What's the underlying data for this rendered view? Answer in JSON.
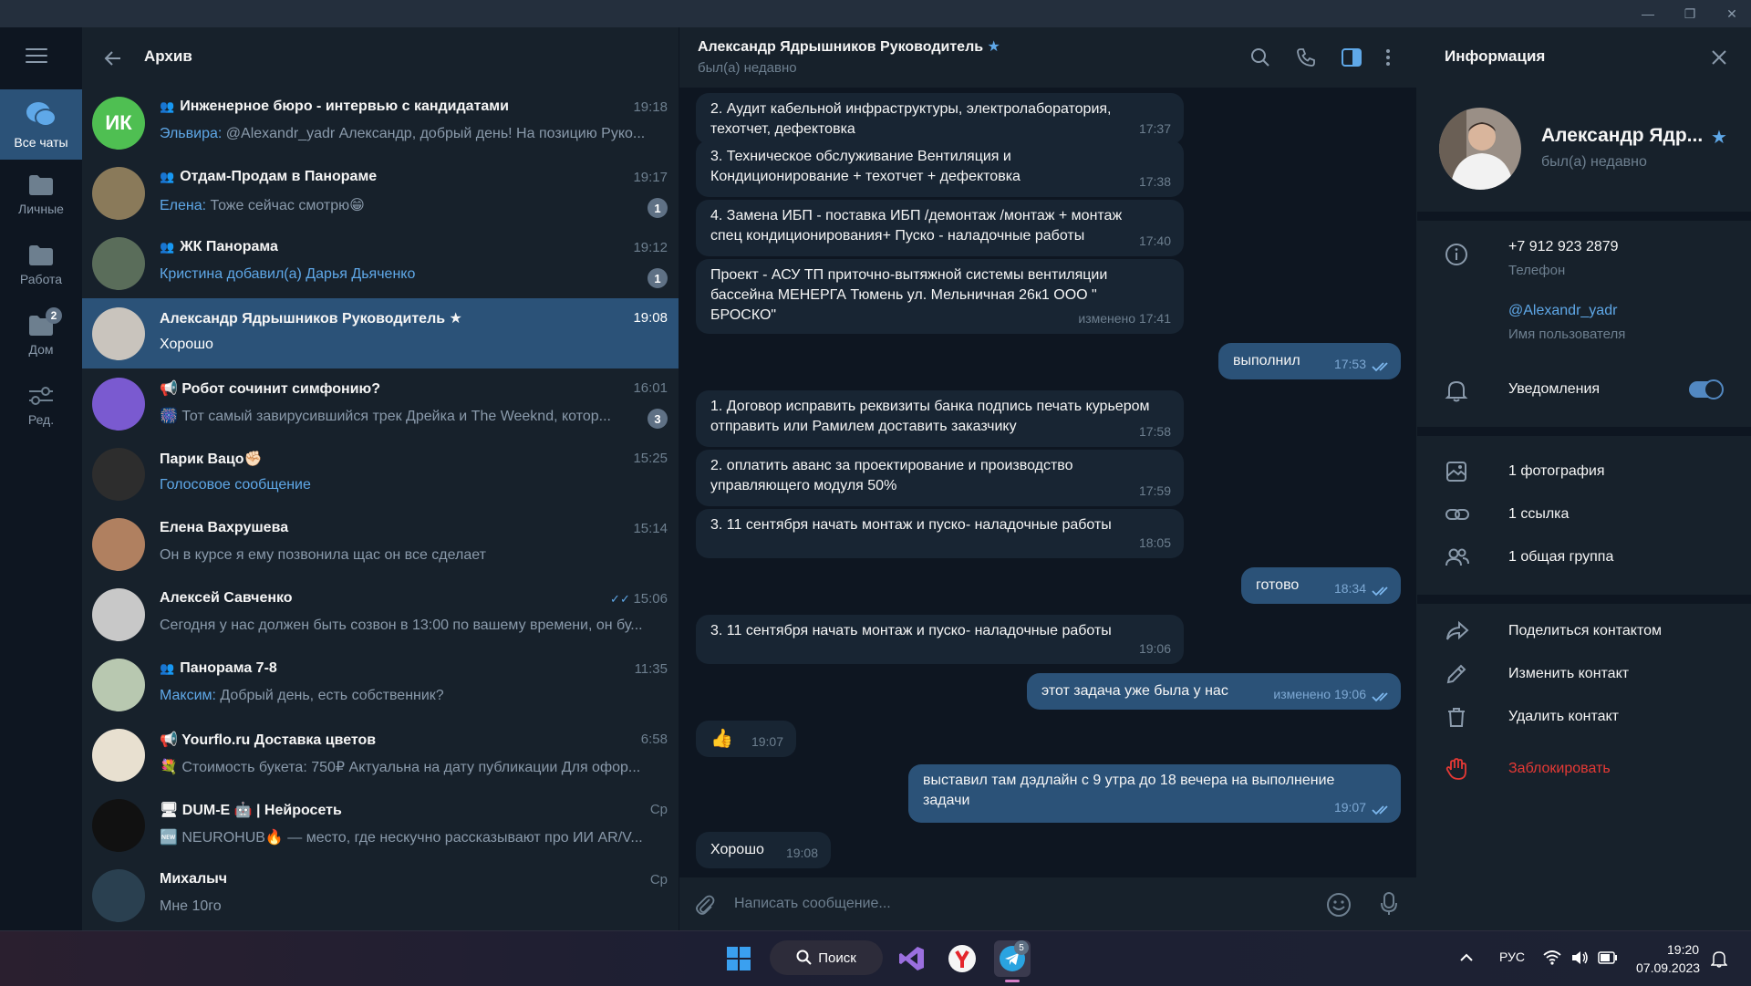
{
  "window": {
    "minimize": "—",
    "restore": "❐",
    "close": "✕"
  },
  "folders": [
    {
      "label": "Все чаты",
      "icon": "chats-icon",
      "active": true
    },
    {
      "label": "Личные",
      "icon": "folder-icon"
    },
    {
      "label": "Работа",
      "icon": "folder-icon"
    },
    {
      "label": "Дом",
      "icon": "folder-icon",
      "badge": "2"
    },
    {
      "label": "Ред.",
      "icon": "edit-folders-icon"
    }
  ],
  "list": {
    "title": "Архив",
    "chats": [
      {
        "name": "Инженерное бюро - интервью с кандидатами",
        "group": true,
        "time": "19:18",
        "sender": "Эльвира:",
        "preview": " @Alexandr_yadr  Александр, добрый день! На позицию Руко...",
        "avatar_text": "ИК",
        "avatar_color": "#4fbf52"
      },
      {
        "name": "Отдам-Продам в Панораме",
        "group": true,
        "time": "19:17",
        "sender": "Елена:",
        "preview": " Тоже сейчас смотрю😁",
        "badge": "1",
        "avatar_color": "#8a7a5a"
      },
      {
        "name": "ЖК Панорама",
        "group": true,
        "time": "19:12",
        "sender": "",
        "preview_blue": "Кристина добавил(а) Дарья Дьяченко",
        "badge": "1",
        "avatar_color": "#5a6d5a"
      },
      {
        "name": "Александр Ядрышников Руководитель ★",
        "time": "19:08",
        "preview": "Хорошо",
        "selected": true,
        "avatar_color": "#c9c4bd"
      },
      {
        "name": "📢 Робот сочинит симфонию?",
        "time": "16:01",
        "preview": "🎆 Тот самый завирусившийся трек Дрейка и The Weeknd, котор...",
        "badge": "3",
        "avatar_color": "#7a5ad0"
      },
      {
        "name": "Парик Вацо✊🏻",
        "time": "15:25",
        "preview_blue": "Голосовое сообщение",
        "avatar_color": "#2d2d2d"
      },
      {
        "name": "Елена Вахрушева",
        "time": "15:14",
        "preview": "Он в курсе я ему позвонила щас он все сделает",
        "avatar_color": "#b08060"
      },
      {
        "name": "Алексей Савченко",
        "time": "15:06",
        "read": true,
        "preview": "Сегодня у нас должен быть созвон в 13:00 по вашему времени, он бу...",
        "avatar_color": "#c8c8c8"
      },
      {
        "name": "Панорама 7-8",
        "group": true,
        "time": "11:35",
        "sender": "Максим:",
        "preview": " Добрый день, есть собственник?",
        "avatar_color": "#b8c8b0"
      },
      {
        "name": "📢 Yourflo.ru Доставка цветов",
        "time": "6:58",
        "preview": "💐 Стоимость букета: 750₽ Актуальна на дату публикации  Для офор...",
        "avatar_color": "#e8e0d0"
      },
      {
        "name": "🖥 DUM-E 🤖 | Нейросеть",
        "time": "Ср",
        "preview": "🆕 NEUROHUB🔥 — место, где нескучно рассказывают про ИИ AR/V...",
        "avatar_color": "#111111"
      },
      {
        "name": "Михалыч",
        "time": "Ср",
        "preview": "Мне 10го",
        "avatar_color": "#2a4050"
      }
    ]
  },
  "chat": {
    "title": "Александр Ядрышников Руководитель",
    "status": "был(а) недавно",
    "messages": [
      {
        "dir": "in",
        "text": "2. Аудит кабельной инфраструктуры, электролаборатория, техотчет, дефектовка",
        "time": "17:37"
      },
      {
        "dir": "in",
        "text": "3. Техническое обслуживание Вентиляция и Кондиционирование + техотчет + дефектовка",
        "time": "17:38"
      },
      {
        "dir": "in",
        "text": "4. Замена ИБП - поставка ИБП /демонтаж /монтаж + монтаж спец кондиционирования+ Пуско - наладочные работы",
        "time": "17:40"
      },
      {
        "dir": "in",
        "text": "Проект - АСУ ТП приточно-вытяжной системы вентиляции бассейна МЕНЕРГА Тюмень ул. Мельничная 26к1 ООО \" БРОСКО\"",
        "time": "изменено 17:41"
      },
      {
        "dir": "out",
        "text": "выполнил",
        "time": "17:53"
      },
      {
        "dir": "in",
        "text": "1. Договор исправить реквизиты банка подпись печать курьером отправить или Рамилем доставить заказчику",
        "time": "17:58"
      },
      {
        "dir": "in",
        "text": "2. оплатить аванс за проектирование и производство управляющего модуля 50%",
        "time": "17:59"
      },
      {
        "dir": "in",
        "text": "3. 11 сентября начать монтаж и пуско- наладочные работы",
        "time": "18:05"
      },
      {
        "dir": "out",
        "text": "готово",
        "time": "18:34"
      },
      {
        "dir": "in",
        "text": "3. 11 сентября начать монтаж и пуско- наладочные работы",
        "time": "19:06"
      },
      {
        "dir": "out",
        "text": "этот задача уже была у нас",
        "time": "изменено 19:06"
      },
      {
        "dir": "in",
        "text": "👍",
        "time": "19:07"
      },
      {
        "dir": "out",
        "text": "выставил там дэдлайн с 9 утра до 18 вечера на выполнение задачи",
        "time": "19:07"
      },
      {
        "dir": "in",
        "text": "Хорошо",
        "time": "19:08"
      }
    ],
    "composer_placeholder": "Написать сообщение..."
  },
  "info": {
    "title": "Информация",
    "name": "Александр Ядр...",
    "status": "был(а) недавно",
    "phone": "+7 912 923 2879",
    "phone_label": "Телефон",
    "username": "@Alexandr_yadr",
    "username_label": "Имя пользователя",
    "notifications": "Уведомления",
    "notifications_on": true,
    "photos": "1 фотография",
    "links": "1 ссылка",
    "groups": "1 общая группа",
    "share": "Поделиться контактом",
    "edit": "Изменить контакт",
    "delete": "Удалить контакт",
    "block": "Заблокировать"
  },
  "taskbar": {
    "search": "Поиск",
    "telegram_badge": "5",
    "lang": "РУС",
    "time": "19:20",
    "date": "07.09.2023"
  },
  "colors": {
    "accent": "#5288c1",
    "selected": "#2b5278",
    "danger": "#e53935",
    "online_blue": "#5fa8e8"
  }
}
